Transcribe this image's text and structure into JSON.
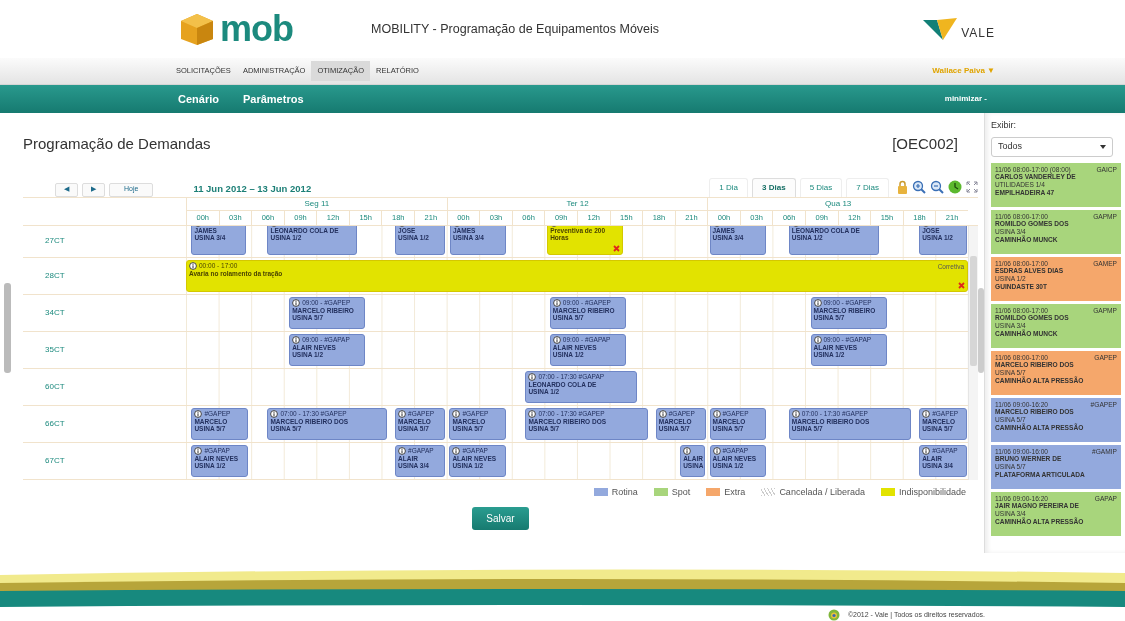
{
  "header": {
    "logo_text": "mob",
    "title": "MOBILITY - Programação de Equipamentos Móveis",
    "brand": "VALE"
  },
  "menu": [
    {
      "label": "SOLICITAÇÕES",
      "selected": false
    },
    {
      "label": "ADMINISTRAÇÃO",
      "selected": false
    },
    {
      "label": "OTIMIZAÇÃO",
      "selected": true
    },
    {
      "label": "RELATÓRIO",
      "selected": false
    }
  ],
  "user": {
    "name": "Wallace Paiva",
    "caret": "▼"
  },
  "submenu": [
    "Cenário",
    "Parâmetros"
  ],
  "minimize": "minimizar -",
  "page": {
    "title": "Programação de Demandas",
    "code": "[OEC002]"
  },
  "toolbar": {
    "prev": "◀",
    "next": "▶",
    "today": "Hoje",
    "range": "11 Jun 2012 – 13 Jun 2012",
    "views": [
      {
        "label": "1 Dia",
        "selected": false
      },
      {
        "label": "3 Dias",
        "selected": true
      },
      {
        "label": "5 Dias",
        "selected": false
      },
      {
        "label": "7 Dias",
        "selected": false
      }
    ]
  },
  "days": [
    {
      "label": "Seg 11",
      "hours": [
        "00h",
        "03h",
        "06h",
        "09h",
        "12h",
        "15h",
        "18h",
        "21h"
      ]
    },
    {
      "label": "Ter 12",
      "hours": [
        "00h",
        "03h",
        "06h",
        "09h",
        "12h",
        "15h",
        "18h",
        "21h"
      ]
    },
    {
      "label": "Qua 13",
      "hours": [
        "00h",
        "03h",
        "06h",
        "09h",
        "12h",
        "15h",
        "18h",
        "21h"
      ]
    }
  ],
  "rows": [
    {
      "resource": "27CT",
      "cut_top": true,
      "events": [
        {
          "kind": "rotina",
          "lines": [
            "JAMES",
            "USINA 3/4"
          ]
        },
        {
          "kind": "rotina",
          "lines": [
            "LEONARDO COLA DE",
            "USINA 1/2"
          ]
        },
        {
          "kind": "rotina",
          "lines": [
            "JOSE",
            "USINA 1/2"
          ]
        },
        {
          "kind": "rotina",
          "lines": [
            "JAMES",
            "USINA 3/4"
          ]
        },
        {
          "kind": "indisponibilidade",
          "lines": [
            "Preventiva de 200",
            "Horas"
          ],
          "removable": true
        },
        {
          "kind": "rotina",
          "lines": [
            "JAMES",
            "USINA 3/4"
          ]
        },
        {
          "kind": "rotina",
          "lines": [
            "LEONARDO COLA DE",
            "USINA 1/2"
          ]
        },
        {
          "kind": "rotina",
          "lines": [
            "JOSE",
            "USINA 1/2"
          ]
        }
      ]
    },
    {
      "resource": "28CT",
      "cut_top": false,
      "events": [
        {
          "kind": "indisponibilidade",
          "header": "00:00 - 17:00",
          "lines": [
            "Avaria no rolamento da tração"
          ],
          "tag": "Corretiva",
          "removable": true
        }
      ]
    },
    {
      "resource": "34CT",
      "cut_top": false,
      "events": [
        {
          "kind": "rotina",
          "header": "09:00 - #GAPEP",
          "lines": [
            "MARCELO RIBEIRO",
            "USINA 5/7"
          ]
        },
        {
          "kind": "rotina",
          "header": "09:00 - #GAPEP",
          "lines": [
            "MARCELO RIBEIRO",
            "USINA 5/7"
          ]
        },
        {
          "kind": "rotina",
          "header": "09:00 - #GAPEP",
          "lines": [
            "MARCELO RIBEIRO",
            "USINA 5/7"
          ]
        }
      ]
    },
    {
      "resource": "35CT",
      "cut_top": false,
      "events": [
        {
          "kind": "rotina",
          "header": "09:00 - #GAPAP",
          "lines": [
            "ALAIR NEVES",
            "USINA 1/2"
          ]
        },
        {
          "kind": "rotina",
          "header": "09:00 - #GAPAP",
          "lines": [
            "ALAIR NEVES",
            "USINA 1/2"
          ]
        },
        {
          "kind": "rotina",
          "header": "09:00 - #GAPAP",
          "lines": [
            "ALAIR NEVES",
            "USINA 1/2"
          ]
        }
      ]
    },
    {
      "resource": "60CT",
      "cut_top": false,
      "events": [
        {
          "kind": "rotina",
          "header": "07:00 - 17:30  #GAPAP",
          "lines": [
            "LEONARDO COLA DE",
            "USINA 1/2"
          ]
        }
      ]
    },
    {
      "resource": "66CT",
      "cut_top": false,
      "events": [
        {
          "kind": "rotina",
          "header": "#GAPEP",
          "lines": [
            "MARCELO",
            "USINA 5/7"
          ]
        },
        {
          "kind": "rotina",
          "header": "07:00 - 17:30  #GAPEP",
          "lines": [
            "MARCELO RIBEIRO DOS",
            "USINA 5/7"
          ]
        },
        {
          "kind": "rotina",
          "header": "#GAPEP",
          "lines": [
            "MARCELO",
            "USINA 5/7"
          ]
        },
        {
          "kind": "rotina",
          "header": "#GAPEP",
          "lines": [
            "MARCELO",
            "USINA 5/7"
          ]
        },
        {
          "kind": "rotina",
          "header": "07:00 - 17:30  #GAPEP",
          "lines": [
            "MARCELO RIBEIRO DOS",
            "USINA 5/7"
          ]
        },
        {
          "kind": "rotina",
          "header": "#GAPEP",
          "lines": [
            "MARCELO",
            "USINA 5/7"
          ]
        },
        {
          "kind": "rotina",
          "header": "#GAPEP",
          "lines": [
            "MARCELO",
            "USINA 5/7"
          ]
        },
        {
          "kind": "rotina",
          "header": "07:00 - 17:30  #GAPEP",
          "lines": [
            "MARCELO RIBEIRO DOS",
            "USINA 5/7"
          ]
        },
        {
          "kind": "rotina",
          "header": "#GAPEP",
          "lines": [
            "MARCELO",
            "USINA 5/7"
          ]
        }
      ]
    },
    {
      "resource": "67CT",
      "cut_top": false,
      "events": [
        {
          "kind": "rotina",
          "header": "#GAPAP",
          "lines": [
            "ALAIR NEVES",
            "USINA 1/2"
          ]
        },
        {
          "kind": "rotina",
          "header": "#GAPAP",
          "lines": [
            "ALAIR",
            "USINA 3/4"
          ]
        },
        {
          "kind": "rotina",
          "header": "#GAPAP",
          "lines": [
            "ALAIR NEVES",
            "USINA 1/2"
          ]
        },
        {
          "kind": "rotina",
          "lines": [
            "ALAIR",
            "USINA"
          ]
        },
        {
          "kind": "rotina",
          "header": "#GAPAP",
          "lines": [
            "ALAIR NEVES",
            "USINA 1/2"
          ]
        },
        {
          "kind": "rotina",
          "header": "#GAPAP",
          "lines": [
            "ALAIR",
            "USINA 3/4"
          ]
        }
      ]
    }
  ],
  "legend": [
    {
      "kind": "rotina",
      "label": "Rotina"
    },
    {
      "kind": "spot",
      "label": "Spot"
    },
    {
      "kind": "extra",
      "label": "Extra"
    },
    {
      "kind": "cancelada",
      "label": "Cancelada / Liberada"
    },
    {
      "kind": "indisponibilidade",
      "label": "Indisponibilidade"
    }
  ],
  "save": "Salvar",
  "sidebar": {
    "label": "Exibir:",
    "filter": "Todos",
    "cards": [
      {
        "kind": "spot",
        "time": "11/06 08:00-17:00 (08:00)",
        "code": "GAICP",
        "name": "CARLOS VANDERLEY DE",
        "location": "UTILIDADES 1/4",
        "equipment": "EMPILHADEIRA 47"
      },
      {
        "kind": "spot",
        "time": "11/06 08:00-17:00",
        "code": "GAPMP",
        "name": "ROMILDO GOMES DOS",
        "location": "USINA 3/4",
        "equipment": "CAMINHÃO MUNCK"
      },
      {
        "kind": "extra",
        "time": "11/06 08:00-17:00",
        "code": "GAMEP",
        "name": "ESDRAS ALVES DIAS",
        "location": "USINA 1/2",
        "equipment": "GUINDASTE 30T"
      },
      {
        "kind": "spot",
        "time": "11/06 08:00-17:00",
        "code": "GAPMP",
        "name": "ROMILDO GOMES DOS",
        "location": "USINA 3/4",
        "equipment": "CAMINHÃO MUNCK"
      },
      {
        "kind": "extra",
        "time": "11/06 08:00-17:00",
        "code": "GAPEP",
        "name": "MARCELO RIBEIRO DOS",
        "location": "USINA 5/7",
        "equipment": "CAMINHÃO ALTA PRESSÃO"
      },
      {
        "kind": "rotina",
        "time": "11/06 09:00-16:20",
        "code": "#GAPEP",
        "name": "MARCELO RIBEIRO DOS",
        "location": "USINA 5/7",
        "equipment": "CAMINHÃO ALTA PRESSÃO"
      },
      {
        "kind": "rotina",
        "time": "11/06 09:00-16:00",
        "code": "#GAMIP",
        "name": "BRUNO WERNER DE",
        "location": "USINA 5/7",
        "equipment": "PLATAFORMA ARTICULADA"
      },
      {
        "kind": "spot",
        "time": "11/06 09:00-16:20",
        "code": "GAPAP",
        "name": "JAIR MAGNO PEREIRA DE",
        "location": "USINA 3/4",
        "equipment": "CAMINHÃO ALTA PRESSÃO"
      }
    ]
  },
  "footer": "©2012 - Vale | Todos os direitos reservados."
}
